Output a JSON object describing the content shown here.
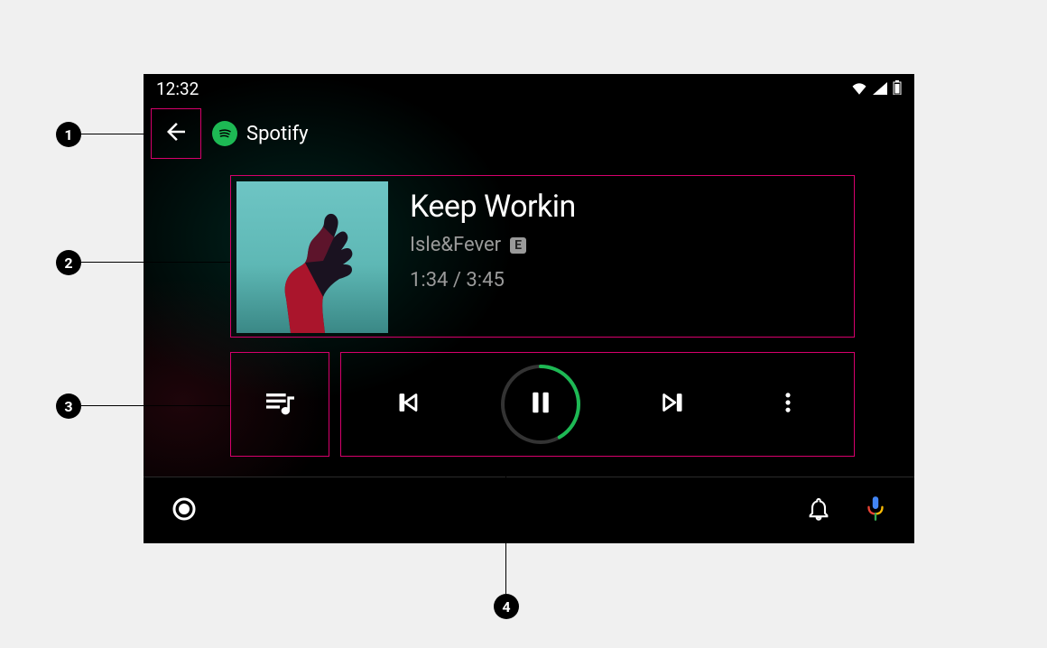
{
  "status": {
    "time": "12:32"
  },
  "app": {
    "name": "Spotify"
  },
  "track": {
    "title": "Keep Workin",
    "artist": "Isle&Fever",
    "explicit_badge": "E",
    "elapsed": "1:34",
    "duration": "3:45",
    "time_separator": " / ",
    "progress_percent": 41.8
  },
  "callouts": {
    "c1": "1",
    "c2": "2",
    "c3": "3",
    "c4": "4"
  },
  "colors": {
    "highlight_border": "#d7006c",
    "spotify_green": "#1DB954"
  }
}
